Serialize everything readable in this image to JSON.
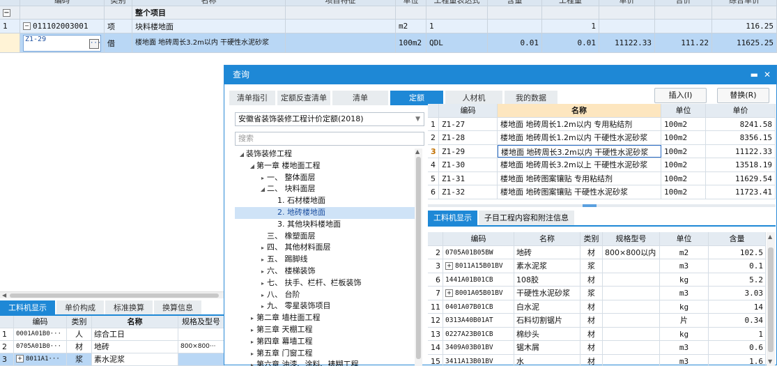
{
  "main_grid": {
    "headers": [
      "",
      "编码",
      "类别",
      "名称",
      "项目特征",
      "单位",
      "工程量表达式",
      "含量",
      "工程量",
      "单价",
      "合价",
      "综合单价"
    ],
    "rows": [
      {
        "idx": "",
        "code": "",
        "cat": "",
        "name": "整个项目",
        "feature": "",
        "unit": "",
        "expr": "",
        "content": "",
        "qty": "",
        "price": "",
        "total": "",
        "comp_price": ""
      },
      {
        "idx": "1",
        "code": "011102003001",
        "cat": "项",
        "name": "块料楼地面",
        "feature": "",
        "unit": "m2",
        "expr": "1",
        "content": "",
        "qty": "1",
        "price": "",
        "total": "",
        "comp_price": "116.25"
      },
      {
        "idx": "",
        "code": "Z1-29",
        "cat": "借",
        "name": "楼地面 地砖周长3.2m以内 干硬性水泥砂浆",
        "feature": "",
        "unit": "100m2",
        "expr": "QDL",
        "content": "0.01",
        "qty": "0.01",
        "price": "11122.33",
        "total": "111.22",
        "comp_price": "11625.25"
      }
    ]
  },
  "bottom_panel": {
    "tabs": [
      "工料机显示",
      "单价构成",
      "标准换算",
      "换算信息"
    ],
    "headers": [
      "",
      "编码",
      "类别",
      "名称",
      "规格及型号"
    ],
    "rows": [
      {
        "idx": "1",
        "code": "0001A01B0···",
        "cat": "人",
        "name": "综合工日",
        "spec": ""
      },
      {
        "idx": "2",
        "code": "0705A01B0···",
        "cat": "材",
        "name": "地砖",
        "spec": "800×800···"
      },
      {
        "idx": "3",
        "code": "8011A1···",
        "cat": "浆",
        "name": "素水泥浆",
        "spec": ""
      }
    ]
  },
  "dialog": {
    "title": "查询",
    "tabs": [
      "清单指引",
      "定额反查清单",
      "清单",
      "定额",
      "人材机",
      "我的数据"
    ],
    "active_tab": "定额",
    "insert_label": "插入(I)",
    "replace_label": "替换(R)",
    "library": "安徽省装饰装修工程计价定额(2018)",
    "search_placeholder": "搜索",
    "tree": [
      {
        "label": "装饰装修工程",
        "level": 0,
        "toggle": "◢"
      },
      {
        "label": "第一章 楼地面工程",
        "level": 1,
        "toggle": "◢"
      },
      {
        "label": "一、 整体面层",
        "level": 2,
        "toggle": "▸"
      },
      {
        "label": "二、 块料面层",
        "level": 2,
        "toggle": "◢"
      },
      {
        "label": "1. 石材楼地面",
        "level": 3,
        "toggle": ""
      },
      {
        "label": "2. 地砖楼地面",
        "level": 3,
        "toggle": "",
        "selected": true
      },
      {
        "label": "3. 其他块料楼地面",
        "level": 3,
        "toggle": ""
      },
      {
        "label": "三、 橡塑面层",
        "level": 2,
        "toggle": ""
      },
      {
        "label": "四、 其他材料面层",
        "level": 2,
        "toggle": "▸"
      },
      {
        "label": "五、 踢脚线",
        "level": 2,
        "toggle": "▸"
      },
      {
        "label": "六、 楼梯装饰",
        "level": 2,
        "toggle": "▸"
      },
      {
        "label": "七、 扶手、栏杆、栏板装饰",
        "level": 2,
        "toggle": "▸"
      },
      {
        "label": "八、 台阶",
        "level": 2,
        "toggle": "▸"
      },
      {
        "label": "九、 零星装饰项目",
        "level": 2,
        "toggle": "▸"
      },
      {
        "label": "第二章 墙柱面工程",
        "level": 1,
        "toggle": "▸"
      },
      {
        "label": "第三章 天棚工程",
        "level": 1,
        "toggle": "▸"
      },
      {
        "label": "第四章 幕墙工程",
        "level": 1,
        "toggle": "▸"
      },
      {
        "label": "第五章 门窗工程",
        "level": 1,
        "toggle": "▸"
      },
      {
        "label": "第六章 油漆、涂料、裱糊工程",
        "level": 1,
        "toggle": "▸"
      }
    ],
    "quota_headers": [
      "",
      "编码",
      "名称",
      "单位",
      "单价"
    ],
    "quota_rows": [
      {
        "idx": "1",
        "code": "Z1-27",
        "name": "楼地面 地砖周长1.2m以内 专用粘结剂",
        "unit": "100m2",
        "price": "8241.58"
      },
      {
        "idx": "2",
        "code": "Z1-28",
        "name": "楼地面 地砖周长1.2m以内 干硬性水泥砂浆",
        "unit": "100m2",
        "price": "8356.15"
      },
      {
        "idx": "3",
        "code": "Z1-29",
        "name": "楼地面 地砖周长3.2m以内 干硬性水泥砂浆",
        "unit": "100m2",
        "price": "11122.33"
      },
      {
        "idx": "4",
        "code": "Z1-30",
        "name": "楼地面 地砖周长3.2m以上 干硬性水泥砂浆",
        "unit": "100m2",
        "price": "13518.19"
      },
      {
        "idx": "5",
        "code": "Z1-31",
        "name": "楼地面 地砖图案镶贴 专用粘结剂",
        "unit": "100m2",
        "price": "11629.54"
      },
      {
        "idx": "6",
        "code": "Z1-32",
        "name": "楼地面 地砖图案镶贴 干硬性水泥砂浆",
        "unit": "100m2",
        "price": "11723.41"
      }
    ],
    "sub_tabs": [
      "工料机显示",
      "子目工程内容和附注信息"
    ],
    "mat_headers": [
      "",
      "编码",
      "名称",
      "类别",
      "规格型号",
      "单位",
      "含量"
    ],
    "mat_rows": [
      {
        "idx": "2",
        "code": "0705A01B05BW",
        "expand": false,
        "name": "地砖",
        "cat": "材",
        "spec": "800×800以内",
        "unit": "m2",
        "qty": "102.5"
      },
      {
        "idx": "3",
        "code": "8011A15B01BV",
        "expand": true,
        "name": "素水泥浆",
        "cat": "浆",
        "spec": "",
        "unit": "m3",
        "qty": "0.1"
      },
      {
        "idx": "6",
        "code": "1441A01B01CB",
        "expand": false,
        "name": "108胶",
        "cat": "材",
        "spec": "",
        "unit": "kg",
        "qty": "5.2"
      },
      {
        "idx": "7",
        "code": "8001A05B01BV",
        "expand": true,
        "name": "干硬性水泥砂浆",
        "cat": "浆",
        "spec": "",
        "unit": "m3",
        "qty": "3.03"
      },
      {
        "idx": "11",
        "code": "0401A07B01CB",
        "expand": false,
        "name": "白水泥",
        "cat": "材",
        "spec": "",
        "unit": "kg",
        "qty": "14"
      },
      {
        "idx": "12",
        "code": "0313A40B01AT",
        "expand": false,
        "name": "石料切割锯片",
        "cat": "材",
        "spec": "",
        "unit": "片",
        "qty": "0.34"
      },
      {
        "idx": "13",
        "code": "0227A23B01CB",
        "expand": false,
        "name": "棉纱头",
        "cat": "材",
        "spec": "",
        "unit": "kg",
        "qty": "1"
      },
      {
        "idx": "14",
        "code": "3409A03B01BV",
        "expand": false,
        "name": "锯木屑",
        "cat": "材",
        "spec": "",
        "unit": "m3",
        "qty": "0.6"
      },
      {
        "idx": "15",
        "code": "3411A13B01BV",
        "expand": false,
        "name": "水",
        "cat": "材",
        "spec": "",
        "unit": "m3",
        "qty": "1.6"
      }
    ]
  },
  "colors": {
    "accent": "#1e88d6",
    "selected_row": "#b9d7f5",
    "header_highlight": "#fde6bf"
  }
}
